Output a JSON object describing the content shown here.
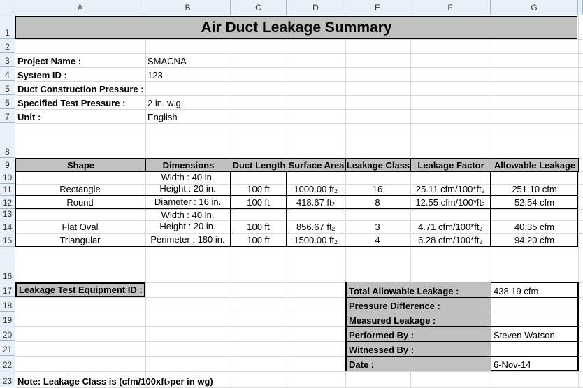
{
  "columns": [
    "A",
    "B",
    "C",
    "D",
    "E",
    "F",
    "G"
  ],
  "rows": [
    "1",
    "2",
    "3",
    "4",
    "5",
    "6",
    "7",
    "8",
    "9",
    "10",
    "11",
    "12",
    "13",
    "14",
    "15",
    "16",
    "17",
    "18",
    "19",
    "20",
    "21",
    "22",
    "23"
  ],
  "title": "Air Duct Leakage Summary",
  "project": {
    "project_name_label": "Project Name :",
    "project_name": "SMACNA",
    "system_id_label": "System ID :",
    "system_id": "123",
    "construction_pressure_label": "Duct Construction Pressure :",
    "test_pressure_label": "Specified Test Pressure :",
    "test_pressure": "2 in. w.g.",
    "unit_label": "Unit :",
    "unit": "English"
  },
  "table": {
    "headers": [
      "Shape",
      "Dimensions",
      "Duct Length",
      "Surface Area",
      "Leakage Class",
      "Leakage Factor",
      "Allowable Leakage"
    ],
    "rows": [
      {
        "shape": "Rectangle",
        "dim1": "Width : 40 in.",
        "dim2": "Height : 20 in.",
        "length": "100 ft",
        "area": "1000.00 ft",
        "cls": "16",
        "factor": "25.11 cfm/100*ft",
        "allowable": "251.10 cfm"
      },
      {
        "shape": "Round",
        "dim1": "",
        "dim2": "Diameter : 16 in.",
        "length": "100 ft",
        "area": "418.67 ft",
        "cls": "8",
        "factor": "12.55 cfm/100*ft",
        "allowable": "52.54 cfm"
      },
      {
        "shape": "Flat Oval",
        "dim1": "Width : 40 in.",
        "dim2": "Height : 20 in.",
        "length": "100 ft",
        "area": "856.67 ft",
        "cls": "3",
        "factor": "4.71 cfm/100*ft",
        "allowable": "40.35 cfm"
      },
      {
        "shape": "Triangular",
        "dim1": "",
        "dim2": "Perimeter : 180 in.",
        "length": "100 ft",
        "area": "1500.00 ft",
        "cls": "4",
        "factor": "6.28 cfm/100*ft",
        "allowable": "94.20 cfm"
      }
    ],
    "sup": "2"
  },
  "equipment_label": "Leakage Test Equipment ID :",
  "summary": [
    {
      "label": "Total Allowable Leakage :",
      "value": "438.19 cfm"
    },
    {
      "label": "Pressure Difference :",
      "value": ""
    },
    {
      "label": "Measured Leakage :",
      "value": ""
    },
    {
      "label": "Performed By :",
      "value": "Steven Watson"
    },
    {
      "label": "Witnessed By :",
      "value": ""
    },
    {
      "label": "Date :",
      "value": "6-Nov-14"
    }
  ],
  "note_prefix": "Note: Leakage Class is (cfm/100xft",
  "note_sup": "2",
  "note_suffix": " per in wg)"
}
